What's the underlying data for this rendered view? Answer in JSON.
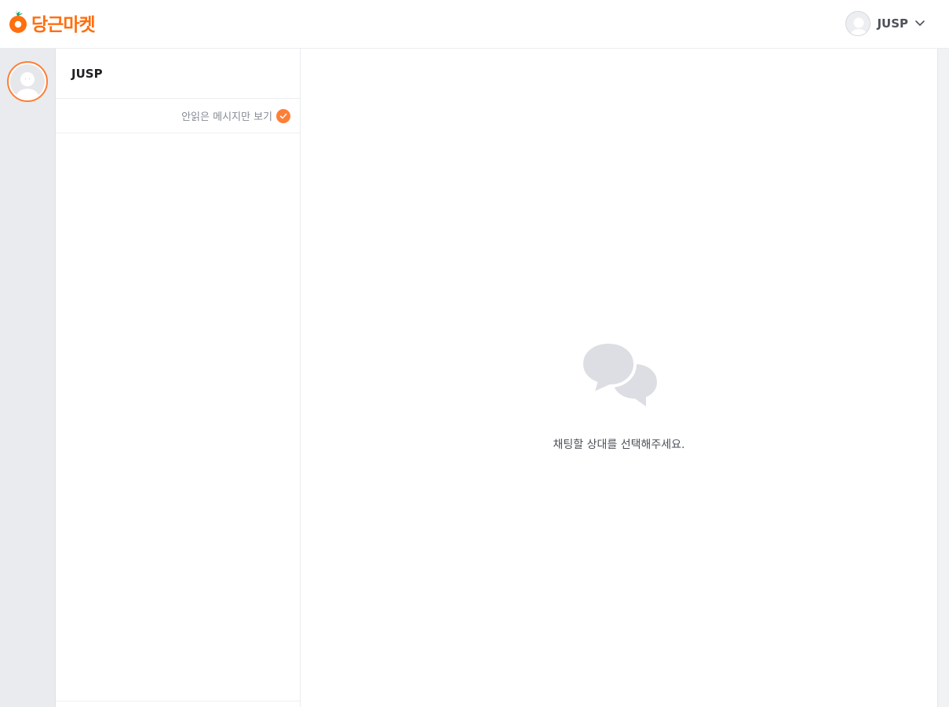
{
  "header": {
    "logo_text": "당근마켓",
    "user_name": "JUSP"
  },
  "chat_list": {
    "title": "JUSP",
    "unread_filter_label": "안읽은 메시지만 보기"
  },
  "main": {
    "empty_message": "채팅할 상대를 선택해주세요."
  },
  "colors": {
    "brand": "#ff6f0f",
    "accent": "#ff7e36",
    "rail_bg": "#e9ebef",
    "icon_gray": "#dcdee3"
  },
  "icons": {
    "logo": "carrot-icon",
    "avatar": "default-profile-icon",
    "dropdown": "chevron-down-icon",
    "check": "check-circle-icon",
    "empty_state": "chat-bubbles-icon"
  }
}
